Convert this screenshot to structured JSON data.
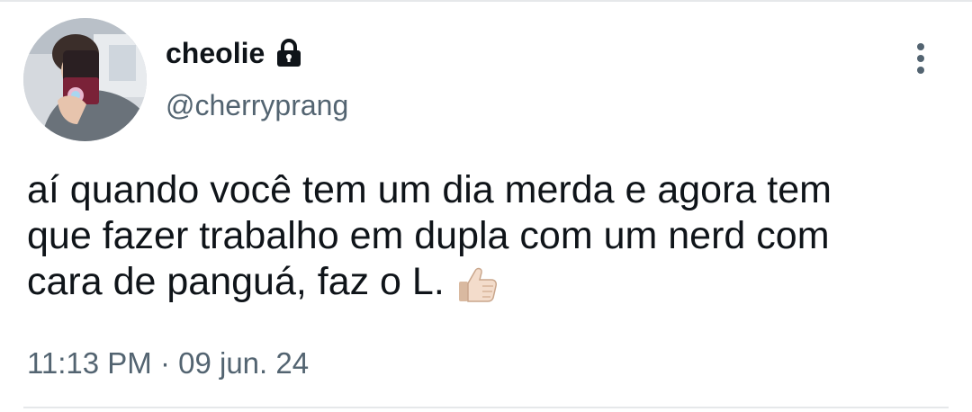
{
  "tweet": {
    "author": {
      "display_name": "cheolie",
      "handle": "@cherryprang",
      "protected_icon": "lock-icon",
      "avatar": "profile-photo"
    },
    "menu_icon": "more-vertical-icon",
    "text_lines": [
      "aí quando você tem um dia merda e agora tem",
      "que fazer trabalho em dupla com um nerd com",
      "cara de panguá, faz o L."
    ],
    "emoji": "thumbs-up-icon",
    "timestamp": "11:13 PM · 09 jun. 24"
  },
  "colors": {
    "text_primary": "#0f1419",
    "text_secondary": "#536471",
    "divider": "#e6e8ea"
  }
}
